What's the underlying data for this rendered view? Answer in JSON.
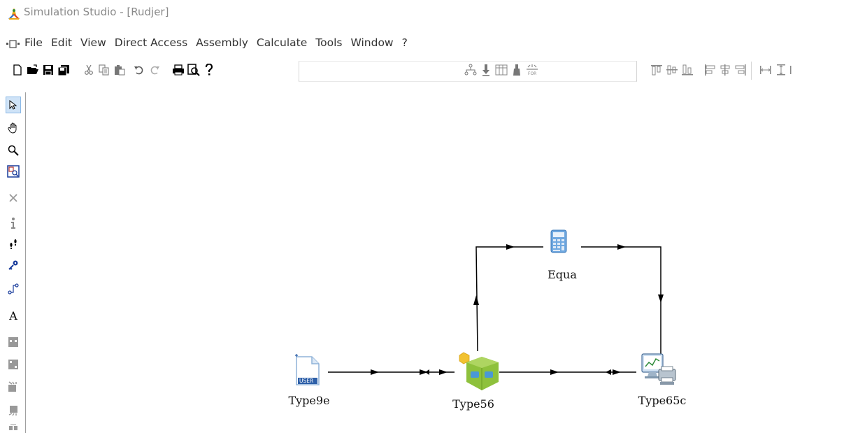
{
  "window": {
    "title": "Simulation Studio - [Rudjer]"
  },
  "menu": {
    "items": [
      "File",
      "Edit",
      "View",
      "Direct Access",
      "Assembly",
      "Calculate",
      "Tools",
      "Window",
      "?"
    ]
  },
  "components": {
    "type9e": {
      "label": "Type9e",
      "icon_text": "USER"
    },
    "type56": {
      "label": "Type56"
    },
    "equa": {
      "label": "Equa"
    },
    "type65c": {
      "label": "Type65c"
    }
  },
  "left_tools": {
    "text_tool_glyph": "A"
  },
  "colors": {
    "link": "#000000",
    "accent_blue": "#1a3d9c",
    "type56_green": "#8ec13c",
    "type56_yellow": "#f2c230"
  }
}
